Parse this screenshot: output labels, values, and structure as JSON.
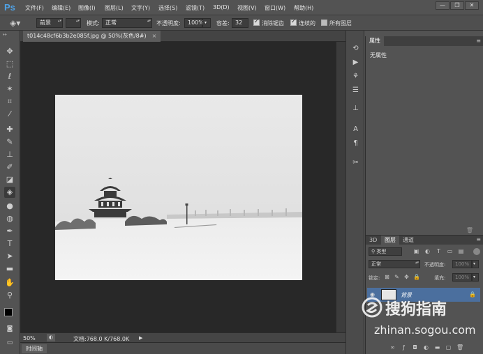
{
  "app": {
    "logo": "Ps"
  },
  "menu": [
    {
      "id": "file",
      "label": "文件(F)"
    },
    {
      "id": "edit",
      "label": "编辑(E)"
    },
    {
      "id": "image",
      "label": "图像(I)"
    },
    {
      "id": "layer",
      "label": "图层(L)"
    },
    {
      "id": "type",
      "label": "文字(Y)"
    },
    {
      "id": "select",
      "label": "选择(S)"
    },
    {
      "id": "filter",
      "label": "滤镜(T)"
    },
    {
      "id": "3d",
      "label": "3D(D)"
    },
    {
      "id": "view",
      "label": "视图(V)"
    },
    {
      "id": "window",
      "label": "窗口(W)"
    },
    {
      "id": "help",
      "label": "帮助(H)"
    }
  ],
  "window_controls": {
    "minimize": "—",
    "restore": "❐",
    "close": "✕"
  },
  "options": {
    "fill_source": "前景",
    "mode_label": "模式:",
    "mode_value": "正常",
    "opacity_label": "不透明度:",
    "opacity_value": "100%",
    "tolerance_label": "容差:",
    "tolerance_value": "32",
    "antialias_label": "消除锯齿",
    "antialias_checked": true,
    "contiguous_label": "连续的",
    "contiguous_checked": true,
    "all_layers_label": "所有图层",
    "all_layers_checked": false
  },
  "tools": [
    {
      "id": "move",
      "icon": "move-icon",
      "glyph": "✥"
    },
    {
      "id": "marquee",
      "icon": "marquee-icon",
      "glyph": "⬚"
    },
    {
      "id": "lasso",
      "icon": "lasso-icon",
      "glyph": "ℓ"
    },
    {
      "id": "magic-wand",
      "icon": "magic-wand-icon",
      "glyph": "✶"
    },
    {
      "id": "crop",
      "icon": "crop-icon",
      "glyph": "⌗"
    },
    {
      "id": "eyedropper",
      "icon": "eyedropper-icon",
      "glyph": "⁄"
    },
    {
      "id": "healing",
      "icon": "healing-brush-icon",
      "glyph": "✚"
    },
    {
      "id": "brush",
      "icon": "brush-icon",
      "glyph": "✎"
    },
    {
      "id": "stamp",
      "icon": "clone-stamp-icon",
      "glyph": "⊥"
    },
    {
      "id": "history-brush",
      "icon": "history-brush-icon",
      "glyph": "✐"
    },
    {
      "id": "eraser",
      "icon": "eraser-icon",
      "glyph": "◪"
    },
    {
      "id": "paint-bucket",
      "icon": "paint-bucket-icon",
      "glyph": "◈",
      "active": true
    },
    {
      "id": "blur",
      "icon": "blur-icon",
      "glyph": "●"
    },
    {
      "id": "dodge",
      "icon": "dodge-icon",
      "glyph": "◍"
    },
    {
      "id": "pen",
      "icon": "pen-icon",
      "glyph": "✒"
    },
    {
      "id": "type",
      "icon": "type-icon",
      "glyph": "T"
    },
    {
      "id": "path-select",
      "icon": "path-selection-icon",
      "glyph": "➤"
    },
    {
      "id": "shape",
      "icon": "rectangle-shape-icon",
      "glyph": "▬"
    },
    {
      "id": "hand",
      "icon": "hand-icon",
      "glyph": "✋"
    },
    {
      "id": "zoom",
      "icon": "zoom-icon",
      "glyph": "⚲"
    }
  ],
  "colors": {
    "foreground": "#000000",
    "background": "#ffffff",
    "accent": "#4fa3e8",
    "selected_layer": "#4b6f9e"
  },
  "document": {
    "tab_title": "t014c48cf6b3b2e085f.jpg @ 50%(灰色/8#)",
    "close_glyph": "×",
    "zoom": "50%",
    "doc_info": "文档:768.0 K/768.0K"
  },
  "timeline": {
    "label": "时间轴"
  },
  "properties_panel": {
    "tab_label": "属性",
    "content": "无属性"
  },
  "layers_panel": {
    "tabs": [
      {
        "id": "3d",
        "label": "3D"
      },
      {
        "id": "layers",
        "label": "图层",
        "active": true
      },
      {
        "id": "channels",
        "label": "通道"
      }
    ],
    "filter_kind": "类型",
    "blend_mode": "正常",
    "opacity_label": "不透明度:",
    "opacity_value": "100%",
    "lock_label": "锁定:",
    "fill_label": "填充:",
    "fill_value": "100%",
    "layers": [
      {
        "name": "背景",
        "visible": true,
        "locked": true
      }
    ]
  },
  "watermark": {
    "brand": "搜狗指南",
    "url": "zhinan.sogou.com"
  }
}
